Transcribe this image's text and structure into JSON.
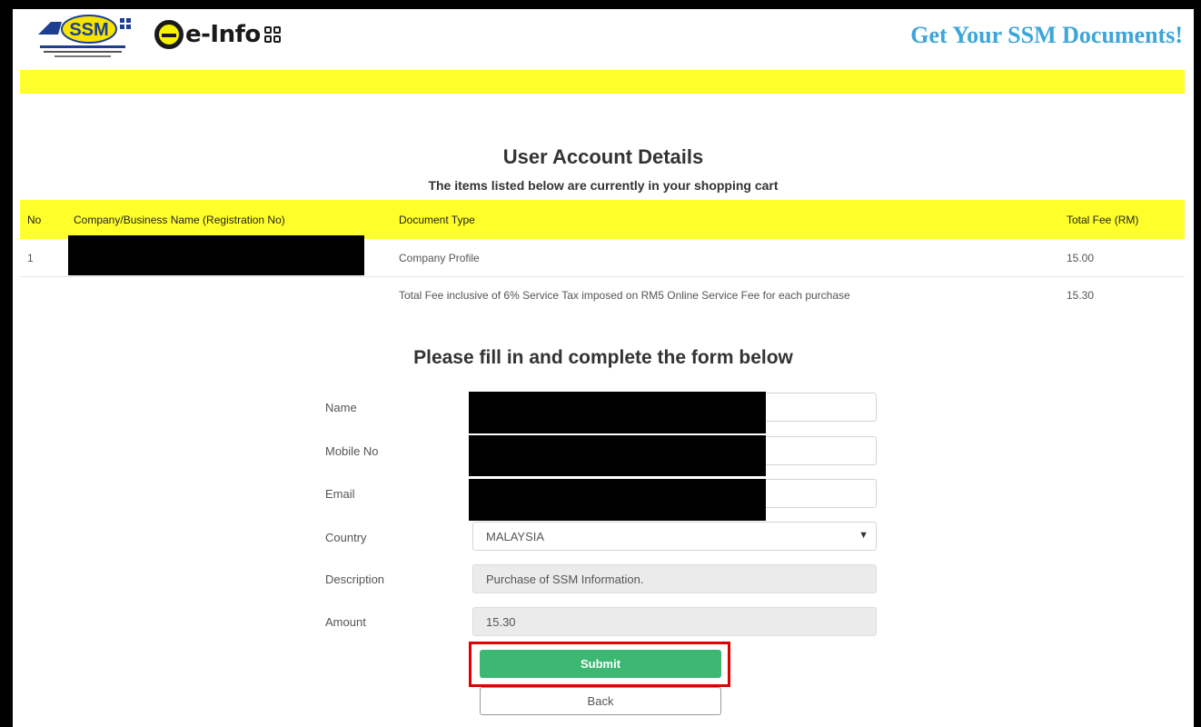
{
  "header": {
    "logo_text": "SSM",
    "brand_name": "e-Info",
    "tagline": "Get Your SSM Documents!",
    "accent_color": "#ffff2a",
    "tagline_color": "#3da5d9"
  },
  "cart": {
    "title": "User Account Details",
    "subtitle": "The items listed below are currently in your shopping cart",
    "columns": [
      "No",
      "Company/Business Name (Registration No)",
      "Document Type",
      "Total Fee (RM)"
    ],
    "rows": [
      {
        "no": "1",
        "name": "",
        "document_type": "Company Profile",
        "fee": "15.00"
      }
    ],
    "total_label": "Total Fee inclusive of 6% Service Tax imposed on RM5 Online Service Fee for each purchase",
    "total_value": "15.30"
  },
  "form": {
    "title": "Please fill in and complete the form below",
    "name_label": "Name",
    "mobile_label": "Mobile No",
    "email_label": "Email",
    "country_label": "Country",
    "country_value": "MALAYSIA",
    "description_label": "Description",
    "description_value": "Purchase of SSM Information.",
    "amount_label": "Amount",
    "amount_value": "15.30",
    "submit_label": "Submit",
    "back_label": "Back",
    "submit_color": "#3cb873",
    "highlight_color": "#e00000"
  }
}
